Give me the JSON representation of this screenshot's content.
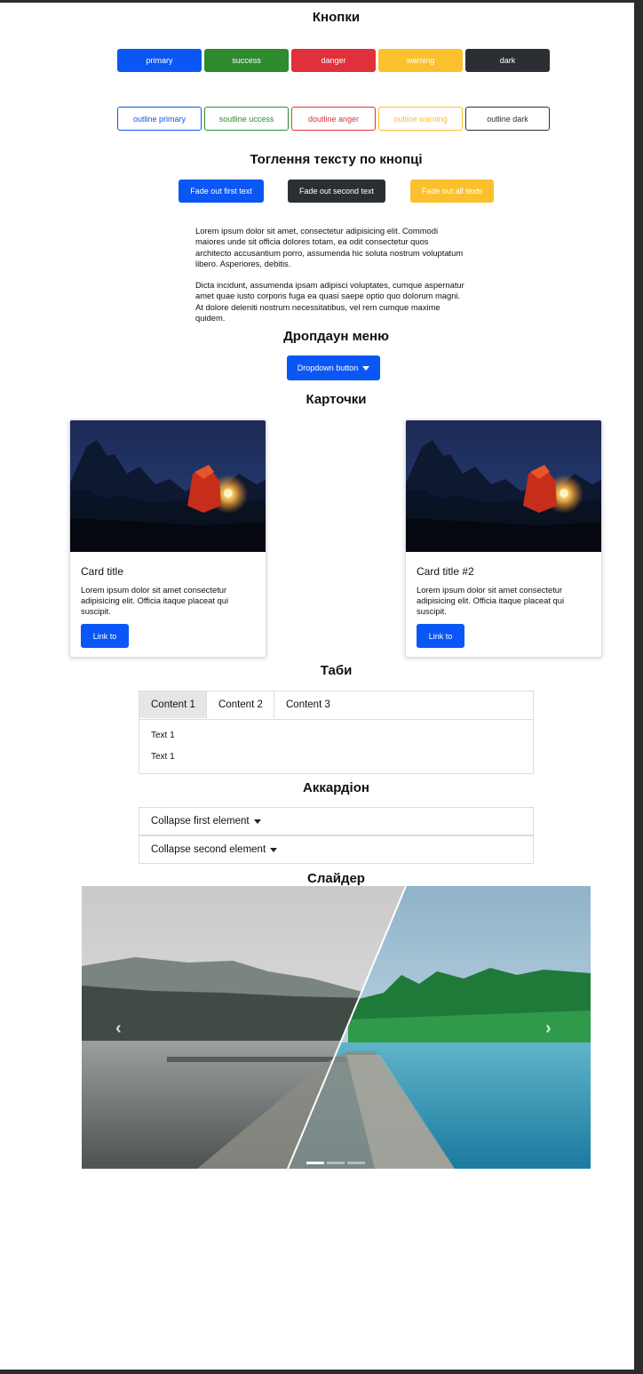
{
  "buttons_section": {
    "title": "Кнопки",
    "solid": [
      {
        "label": "primary",
        "color": "#0b57f5"
      },
      {
        "label": "success",
        "color": "#2e8b2e"
      },
      {
        "label": "danger",
        "color": "#e0303c"
      },
      {
        "label": "warning",
        "color": "#fbc02d"
      },
      {
        "label": "dark",
        "color": "#2b2f33"
      }
    ],
    "outline": [
      {
        "label": "outline primary",
        "color": "#0b57f5"
      },
      {
        "label": "soutline uccess",
        "color": "#2e8b2e"
      },
      {
        "label": "doutline anger",
        "color": "#e0303c"
      },
      {
        "label": "outline warning",
        "color": "#fbc02d"
      },
      {
        "label": "outline dark",
        "color": "#2b2f33"
      }
    ]
  },
  "toggle_section": {
    "title": "Тоглення тексту по кнопці",
    "buttons": [
      {
        "label": "Fade out first text",
        "color": "#0b57f5"
      },
      {
        "label": "Fade out second text",
        "color": "#2b2f33"
      },
      {
        "label": "Fade out all texts",
        "color": "#fbc02d"
      }
    ],
    "paragraph_1": "Lorem ipsum dolor sit amet, consectetur adipisicing elit. Commodi maiores unde sit officia dolores totam, ea odit consectetur quos architecto accusantium porro, assumenda hic soluta nostrum voluptatum libero. Asperiores, debitis.",
    "paragraph_2": "Dicta incidunt, assumenda ipsam adipisci voluptates, cumque aspernatur amet quae iusto corporis fuga ea quasi saepe optio quo dolorum magni. At dolore deleniti nostrum necessitatibus, vel rem cumque maxime quidem."
  },
  "dropdown_section": {
    "title": "Дропдаун меню",
    "button_label": "Dropdown button"
  },
  "cards_section": {
    "title": "Карточки",
    "cards": [
      {
        "title": "Card title",
        "text": "Lorem ipsum dolor sit amet consectetur adipisicing elit. Officia itaque placeat qui suscipit.",
        "link_label": "Link to"
      },
      {
        "title": "Card title #2",
        "text": "Lorem ipsum dolor sit amet consectetur adipisicing elit. Officia itaque placeat qui suscipit.",
        "link_label": "Link to"
      }
    ]
  },
  "tabs_section": {
    "title": "Таби",
    "tabs": [
      "Content 1",
      "Content 2",
      "Content 3"
    ],
    "active_tab": "Content 1",
    "content_lines": [
      "Text 1",
      "Text 1"
    ]
  },
  "accordion_section": {
    "title": "Аккардіон",
    "items": [
      "Collapse first element",
      "Collapse second element"
    ]
  },
  "slider_section": {
    "title": "Слайдер",
    "prev_icon": "chevron-left-icon",
    "next_icon": "chevron-right-icon",
    "indicator_count": 3,
    "active_indicator": 1
  }
}
